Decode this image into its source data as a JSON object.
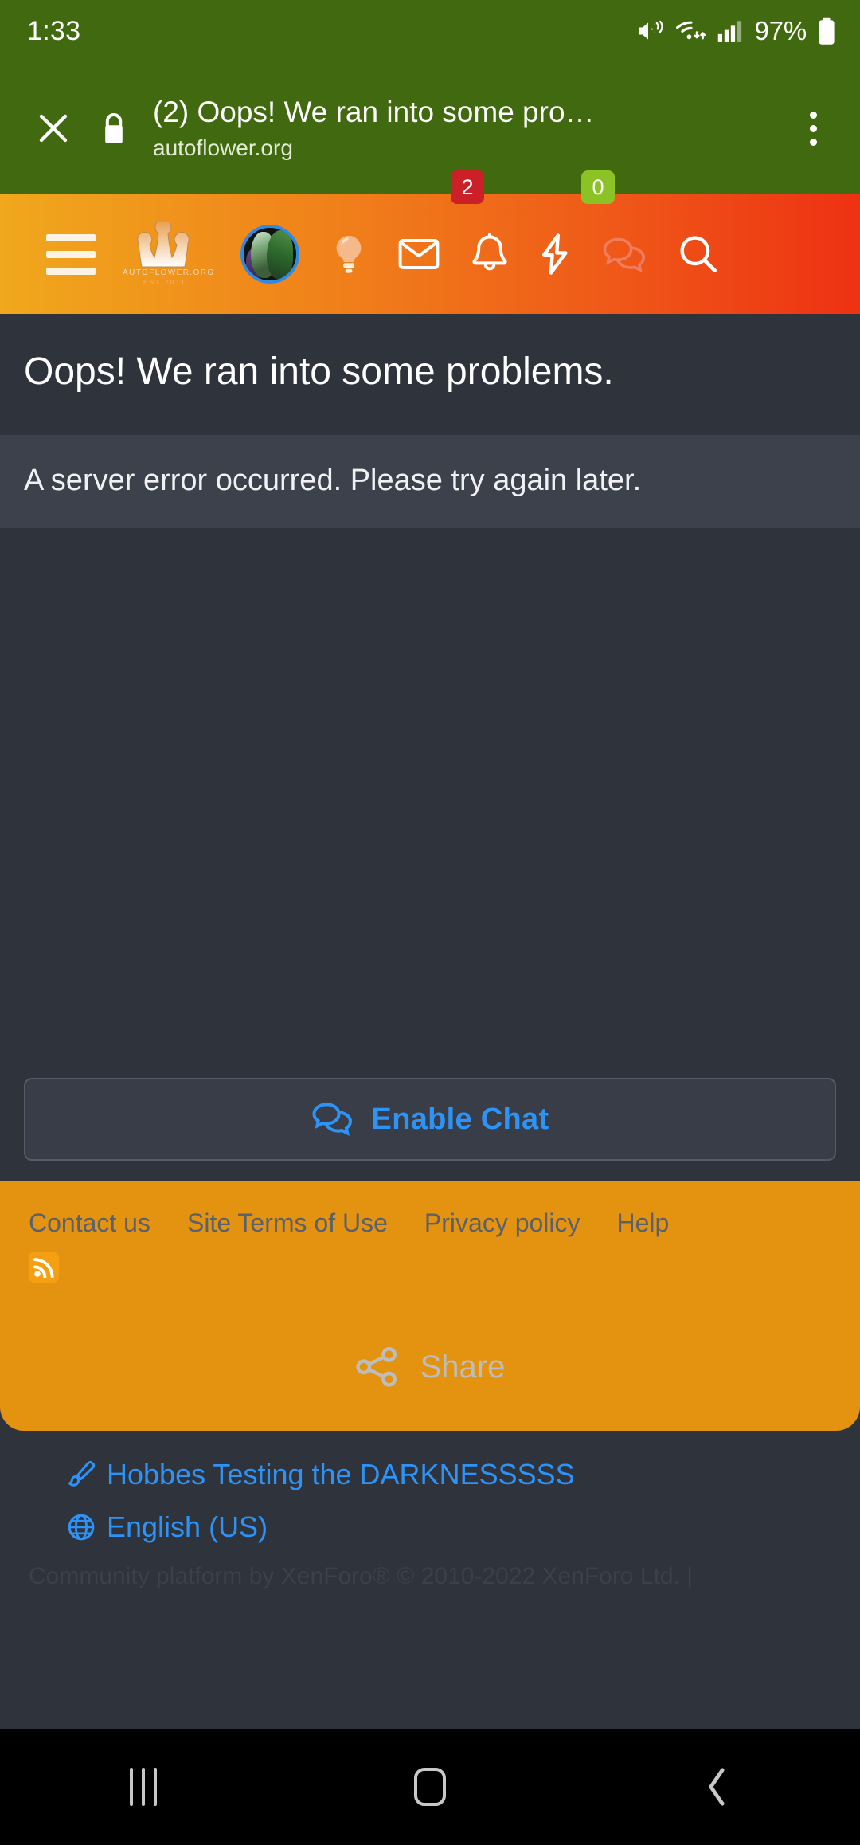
{
  "statusbar": {
    "clock": "1:33",
    "battery_percent": "97%",
    "icons": [
      "mute-icon",
      "wifi-icon",
      "signal-icon",
      "battery-icon"
    ]
  },
  "tabheader": {
    "close_icon": "close-icon",
    "lock_icon": "lock-icon",
    "title": "(2) Oops! We ran into some pro…",
    "url": "autoflower.org",
    "menu_icon": "overflow-menu-icon",
    "background_color": "#41690f"
  },
  "sitenav": {
    "hamburger_label": "menu-icon",
    "logo": {
      "name": "autoflower-crown-logo",
      "line1": "AUTOFLOWER.ORG",
      "line2": "EST 2011"
    },
    "avatar_label": "user-avatar",
    "items": [
      {
        "icon": "lightbulb-icon",
        "badge": null
      },
      {
        "icon": "mail-icon",
        "badge": null
      },
      {
        "icon": "bell-icon",
        "badge": "2",
        "badge_color": "#cc2029"
      },
      {
        "icon": "lightning-icon",
        "badge": null
      },
      {
        "icon": "chat-bubbles-icon",
        "badge": "0",
        "badge_color": "#8bc225"
      },
      {
        "icon": "search-icon",
        "badge": null
      }
    ],
    "gradient_from": "#f0a81c",
    "gradient_to": "#ee3113"
  },
  "error": {
    "title": "Oops! We ran into some problems.",
    "description": "A server error occurred. Please try again later."
  },
  "chat": {
    "icon": "chat-bubbles-icon",
    "label": "Enable Chat",
    "accent_color": "#2e93f7"
  },
  "footer": {
    "background_color": "#e3930f",
    "links": [
      {
        "label": "Contact us"
      },
      {
        "label": "Site Terms of Use"
      },
      {
        "label": "Privacy policy"
      },
      {
        "label": "Help"
      }
    ],
    "rss_icon": "rss-icon",
    "share": {
      "icon": "share-icon",
      "label": "Share"
    }
  },
  "bottom": {
    "style_link": {
      "icon": "paintbrush-icon",
      "label": "Hobbes Testing the DARKNESSSSS"
    },
    "language_link": {
      "icon": "globe-icon",
      "label": "English (US)"
    },
    "copyright": "Community platform by XenForo® © 2010-2022 XenForo Ltd. |"
  },
  "androidnav": {
    "recents": "recents-icon",
    "home": "home-icon",
    "back": "back-icon"
  }
}
